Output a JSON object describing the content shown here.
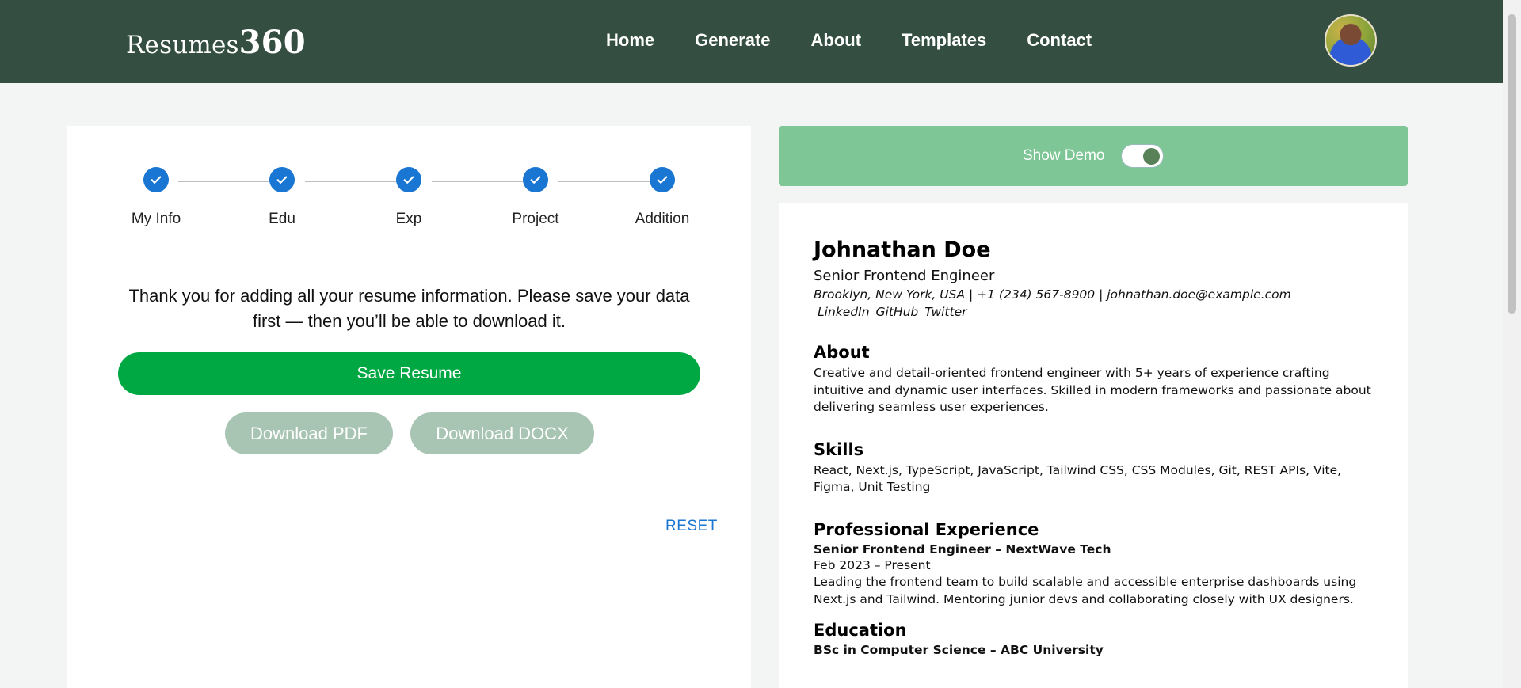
{
  "header": {
    "logo_text": "Resumes",
    "logo_num": "360",
    "nav": [
      "Home",
      "Generate",
      "About",
      "Templates",
      "Contact"
    ]
  },
  "stepper": {
    "steps": [
      "My Info",
      "Edu",
      "Exp",
      "Project",
      "Addition"
    ]
  },
  "main": {
    "message": "Thank you for adding all your resume information. Please save your data first — then you’ll be able to download it.",
    "save_label": "Save Resume",
    "download_pdf_label": "Download PDF",
    "download_docx_label": "Download DOCX",
    "reset_label": "RESET"
  },
  "demo": {
    "label": "Show Demo",
    "enabled": true
  },
  "resume": {
    "name": "Johnathan Doe",
    "title": "Senior Frontend Engineer",
    "contact": "Brooklyn, New York, USA | +1 (234) 567-8900 | johnathan.doe@example.com",
    "links": [
      "LinkedIn",
      "GitHub",
      "Twitter"
    ],
    "about_heading": "About",
    "about_text": "Creative and detail-oriented frontend engineer with 5+ years of experience crafting intuitive and dynamic user interfaces. Skilled in modern frameworks and passionate about delivering seamless user experiences.",
    "skills_heading": "Skills",
    "skills_text": "React, Next.js, TypeScript, JavaScript, Tailwind CSS, CSS Modules, Git, REST APIs, Vite, Figma, Unit Testing",
    "experience_heading": "Professional Experience",
    "experience_role": "Senior Frontend Engineer – NextWave Tech",
    "experience_dates": "Feb 2023 – Present",
    "experience_text": "Leading the frontend team to build scalable and accessible enterprise dashboards using Next.js and Tailwind. Mentoring junior devs and collaborating closely with UX designers.",
    "education_heading": "Education",
    "education_degree": "BSc in Computer Science – ABC University"
  },
  "colors": {
    "header_bg": "#344e41",
    "step_blue": "#1976d2",
    "save_green": "#00a844",
    "download_disabled": "#a8c4b3",
    "demo_bar": "#7ec695"
  }
}
